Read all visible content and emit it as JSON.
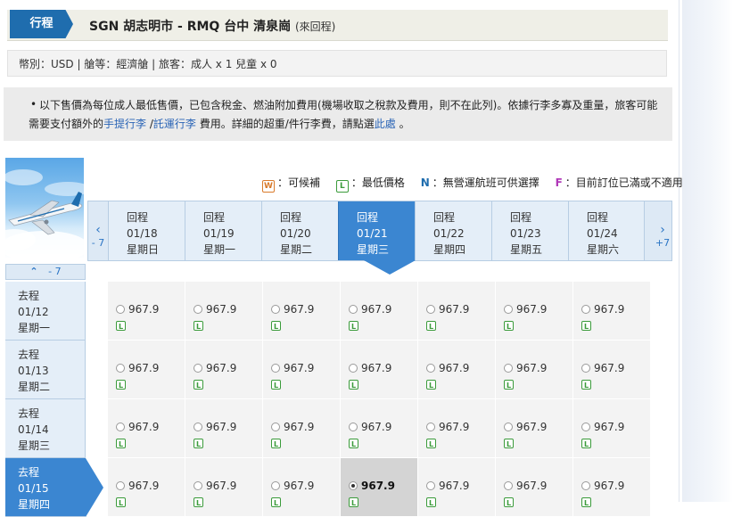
{
  "header": {
    "tab_label": "行程",
    "route": "SGN 胡志明市 - RMQ 台中 清泉崗",
    "route_sub": "(來回程)"
  },
  "fare_info": "幣別：USD | 艙等：經濟艙 | 旅客：成人 x 1 兒童 x 0",
  "notice": {
    "bullet": "•",
    "text_a": "以下售價為每位成人最低售價，已包含稅金、燃油附加費用(機場收取之稅款及費用，則不在此列)。依據行李多寡及重量，旅客可能需要支付額外的",
    "link_carry": "手提行李",
    "sep": " /",
    "link_checked": "託運行李",
    "text_b": " 費用。詳細的超重/件行李費，請點選",
    "link_here": "此處",
    "text_c": " 。"
  },
  "legend": {
    "w_icon": "W",
    "w_label": "：可候補",
    "l_icon": "L",
    "l_label": "：最低價格",
    "n_icon": "N",
    "n_label": "：無營運航班可供選擇",
    "f_icon": "F",
    "f_label": "：目前訂位已滿或不適用"
  },
  "return_nav": {
    "prev_arrow": "‹",
    "prev_label": "- 7",
    "next_arrow": "›",
    "next_label": "+7"
  },
  "return_dates": [
    {
      "label": "回程",
      "date": "01/18",
      "weekday": "星期日"
    },
    {
      "label": "回程",
      "date": "01/19",
      "weekday": "星期一"
    },
    {
      "label": "回程",
      "date": "01/20",
      "weekday": "星期二"
    },
    {
      "label": "回程",
      "date": "01/21",
      "weekday": "星期三"
    },
    {
      "label": "回程",
      "date": "01/22",
      "weekday": "星期四"
    },
    {
      "label": "回程",
      "date": "01/23",
      "weekday": "星期五"
    },
    {
      "label": "回程",
      "date": "01/24",
      "weekday": "星期六"
    }
  ],
  "depart_nav": {
    "up_arrow": "⌃",
    "up_label": "- 7"
  },
  "depart_dates": [
    {
      "label": "去程",
      "date": "01/12",
      "weekday": "星期一"
    },
    {
      "label": "去程",
      "date": "01/13",
      "weekday": "星期二"
    },
    {
      "label": "去程",
      "date": "01/14",
      "weekday": "星期三"
    },
    {
      "label": "去程",
      "date": "01/15",
      "weekday": "星期四"
    }
  ],
  "price": "967.9",
  "fare_tag": "L",
  "selected": {
    "depart_index": 3,
    "return_index": 3
  },
  "colors": {
    "accent": "#3b86d1",
    "header_tab": "#1f6dae",
    "lowest_tag": "#3b9b3b",
    "waitlist_tag": "#d97a2b",
    "full_tag": "#b038b8"
  }
}
